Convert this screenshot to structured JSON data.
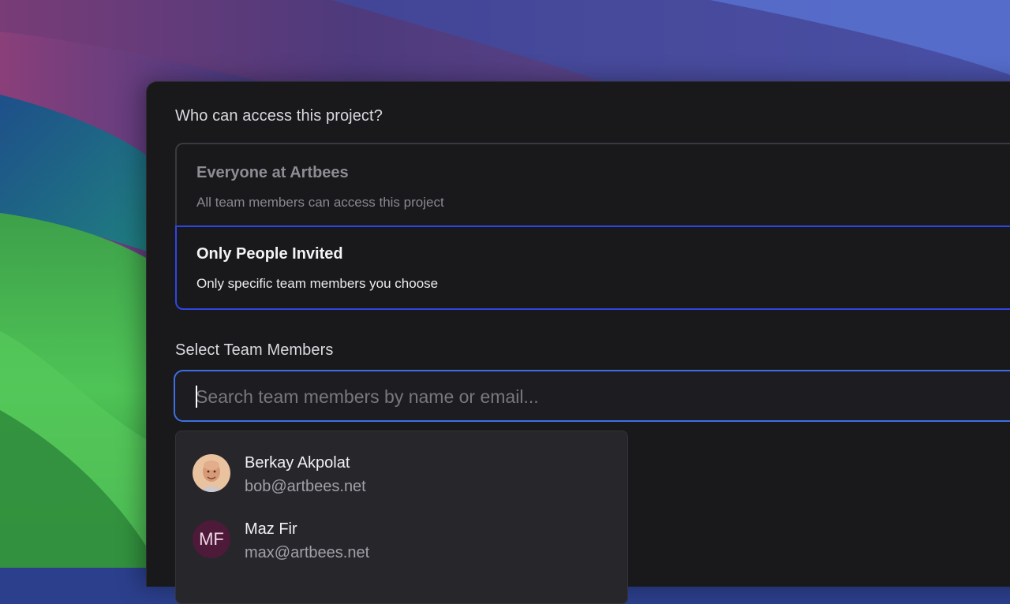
{
  "access": {
    "question": "Who can access this project?",
    "options": [
      {
        "title": "Everyone at Artbees",
        "description": "All team members can access this project",
        "selected": false
      },
      {
        "title": "Only People Invited",
        "description": "Only specific team members you choose",
        "selected": true
      }
    ]
  },
  "team": {
    "label": "Select Team Members",
    "search": {
      "value": "",
      "placeholder": "Search team members by name or email..."
    },
    "results": [
      {
        "name": "Berkay Akpolat",
        "email": "bob@artbees.net",
        "avatar": "photo"
      },
      {
        "name": "Maz Fir",
        "email": "max@artbees.net",
        "avatar": "initials",
        "initials": "MF",
        "avatar_color": "#4d1a3a"
      }
    ]
  },
  "colors": {
    "accent": "#2f46e6",
    "focus_ring": "#3d6fe3",
    "panel_bg": "#19191c"
  }
}
